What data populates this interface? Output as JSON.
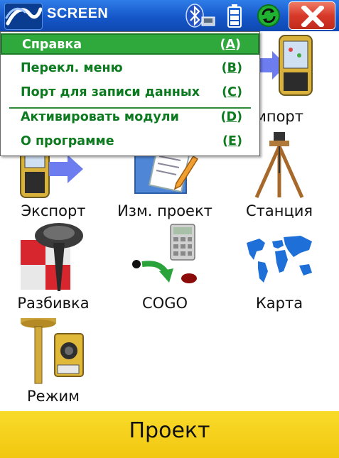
{
  "titlebar": {
    "title": "SCREEN",
    "logo_icon": "company-logo",
    "status_icons": [
      "bluetooth-icon",
      "battery-icon",
      "sync-icon"
    ],
    "close_icon": "close-icon"
  },
  "menu": {
    "items": [
      {
        "label": "Справка",
        "key_open": "(",
        "key": "A",
        "key_close": ")",
        "selected": true
      },
      {
        "label": "Перекл. меню",
        "key_open": "(",
        "key": "B",
        "key_close": ")"
      },
      {
        "label": "Порт для записи данных",
        "key_open": "(",
        "key": "C",
        "key_close": ")"
      },
      {
        "label": "Активировать модули",
        "key_open": "(",
        "key": "D",
        "key_close": ")"
      },
      {
        "label": "О программе",
        "key_open": "(",
        "key": "E",
        "key_close": ")"
      }
    ]
  },
  "tiles": [
    {
      "label": "Импорт",
      "visible_label": "мпорт",
      "icon": "import-icon"
    },
    {
      "label": "Экспорт",
      "icon": "export-icon"
    },
    {
      "label": "Изм. проект",
      "icon": "edit-project-icon"
    },
    {
      "label": "Станция",
      "icon": "station-tripod-icon"
    },
    {
      "label": "Разбивка",
      "icon": "stakeout-icon"
    },
    {
      "label": "COGO",
      "icon": "cogo-calculator-icon"
    },
    {
      "label": "Карта",
      "icon": "map-icon"
    },
    {
      "label": "Режим",
      "icon": "mode-instruments-icon"
    }
  ],
  "bottom": {
    "label": "Проект"
  },
  "colors": {
    "titlebar": "#1557c9",
    "menu_text": "#0c7a1e",
    "menu_selected_bg": "#2fa83c",
    "bottom_bar": "#f1c710",
    "close_button": "#d7392a"
  }
}
